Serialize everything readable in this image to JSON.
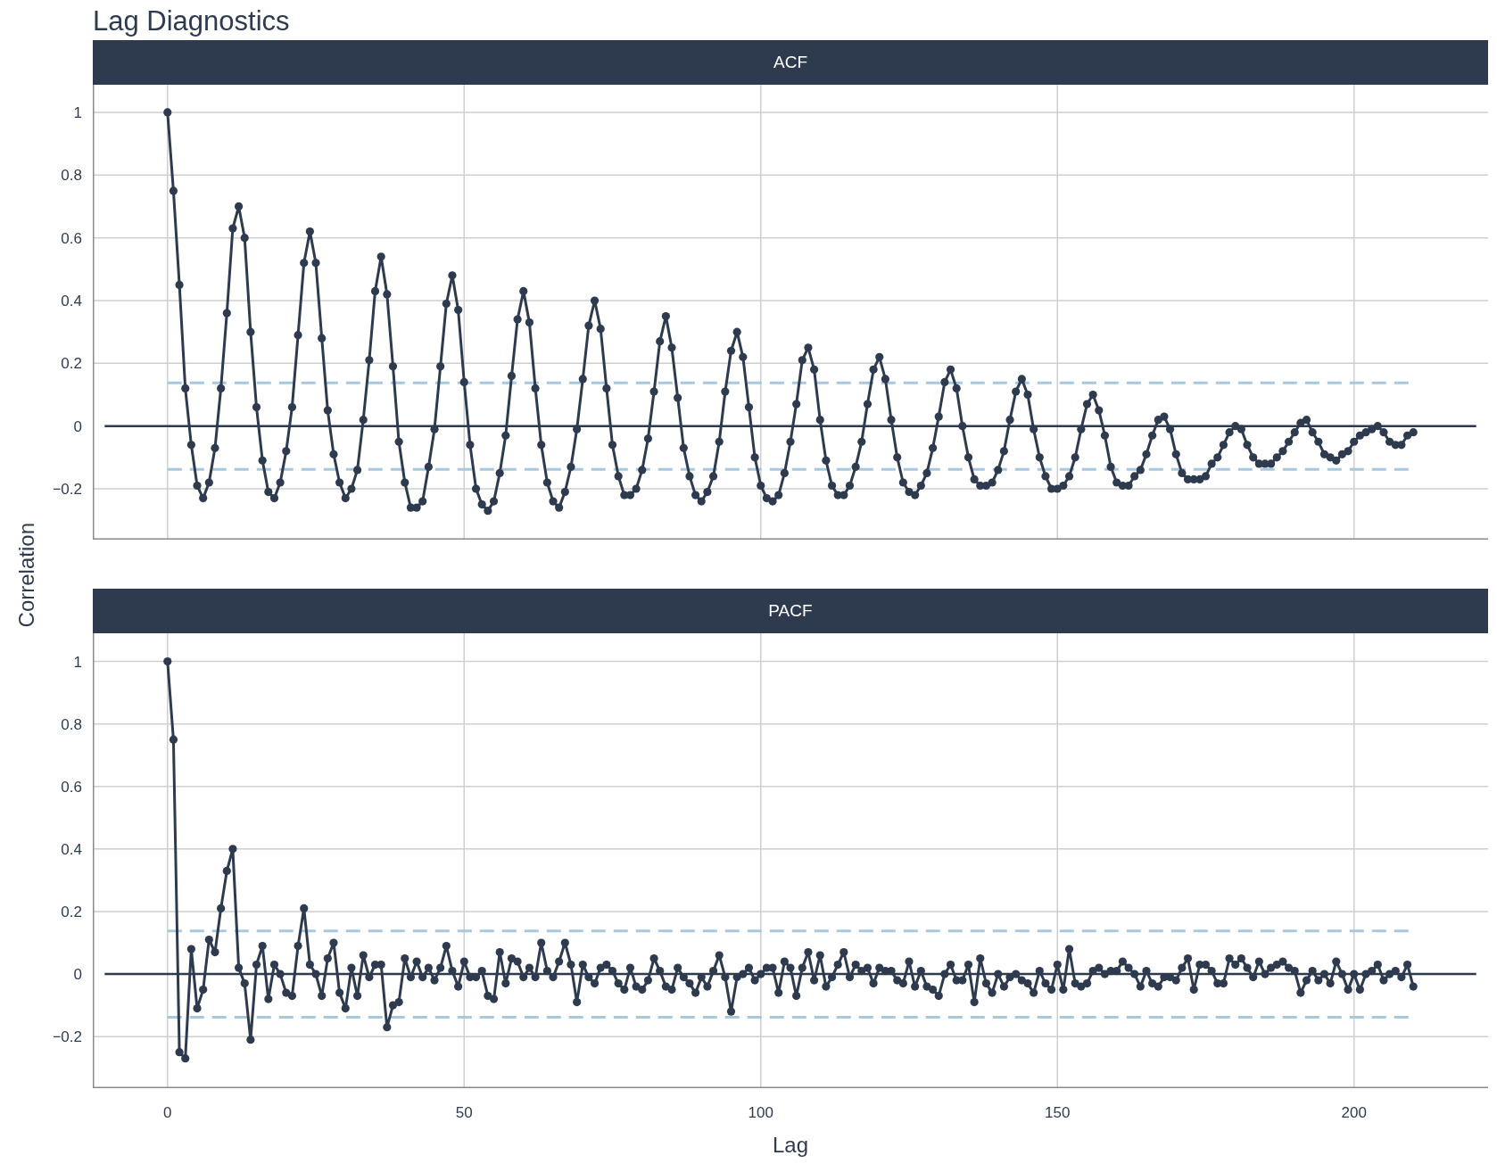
{
  "title": "Lag Diagnostics",
  "ylabel": "Correlation",
  "charts": [
    {
      "chart_data": {
        "type": "line",
        "title": "ACF",
        "x": [
          0,
          1,
          2,
          3,
          4,
          5,
          6,
          7,
          8,
          9,
          10,
          11,
          12,
          13,
          14,
          15,
          16,
          17,
          18,
          19,
          20,
          21,
          22,
          23,
          24,
          25,
          26,
          27,
          28,
          29,
          30,
          31,
          32,
          33,
          34,
          35,
          36,
          37,
          38,
          39,
          40,
          41,
          42,
          43,
          44,
          45,
          46,
          47,
          48,
          49,
          50,
          51,
          52,
          53,
          54,
          55,
          56,
          57,
          58,
          59,
          60,
          61,
          62,
          63,
          64,
          65,
          66,
          67,
          68,
          69,
          70,
          71,
          72,
          73,
          74,
          75,
          76,
          77,
          78,
          79,
          80,
          81,
          82,
          83,
          84,
          85,
          86,
          87,
          88,
          89,
          90,
          91,
          92,
          93,
          94,
          95,
          96,
          97,
          98,
          99,
          100,
          101,
          102,
          103,
          104,
          105,
          106,
          107,
          108,
          109,
          110,
          111,
          112,
          113,
          114,
          115,
          116,
          117,
          118,
          119,
          120,
          121,
          122,
          123,
          124,
          125,
          126,
          127,
          128,
          129,
          130,
          131,
          132,
          133,
          134,
          135,
          136,
          137,
          138,
          139,
          140,
          141,
          142,
          143,
          144,
          145,
          146,
          147,
          148,
          149,
          150,
          151,
          152,
          153,
          154,
          155,
          156,
          157,
          158,
          159,
          160,
          161,
          162,
          163,
          164,
          165,
          166,
          167,
          168,
          169,
          170,
          171,
          172,
          173,
          174,
          175,
          176,
          177,
          178,
          179,
          180,
          181,
          182,
          183,
          184,
          185,
          186,
          187,
          188,
          189,
          190,
          191,
          192,
          193,
          194,
          195,
          196,
          197,
          198,
          199,
          200,
          201,
          202,
          203,
          204,
          205,
          206,
          207,
          208,
          209,
          210
        ],
        "series": [
          {
            "color": "#2e3b4e",
            "marker": "circle",
            "values": [
              1,
              0.75,
              0.45,
              0.12,
              -0.06,
              -0.19,
              -0.23,
              -0.18,
              -0.07,
              0.12,
              0.36,
              0.63,
              0.7,
              0.6,
              0.3,
              0.06,
              -0.11,
              -0.21,
              -0.23,
              -0.18,
              -0.08,
              0.06,
              0.29,
              0.52,
              0.62,
              0.52,
              0.28,
              0.05,
              -0.09,
              -0.18,
              -0.23,
              -0.2,
              -0.14,
              0.02,
              0.21,
              0.43,
              0.54,
              0.42,
              0.19,
              -0.05,
              -0.18,
              -0.26,
              -0.26,
              -0.24,
              -0.13,
              -0.01,
              0.19,
              0.39,
              0.48,
              0.37,
              0.14,
              -0.06,
              -0.2,
              -0.25,
              -0.27,
              -0.24,
              -0.15,
              -0.03,
              0.16,
              0.34,
              0.43,
              0.33,
              0.12,
              -0.06,
              -0.18,
              -0.24,
              -0.26,
              -0.21,
              -0.13,
              -0.01,
              0.15,
              0.32,
              0.4,
              0.31,
              0.12,
              -0.06,
              -0.16,
              -0.22,
              -0.22,
              -0.2,
              -0.14,
              -0.04,
              0.11,
              0.27,
              0.35,
              0.25,
              0.09,
              -0.07,
              -0.16,
              -0.22,
              -0.24,
              -0.21,
              -0.16,
              -0.05,
              0.11,
              0.24,
              0.3,
              0.22,
              0.06,
              -0.1,
              -0.19,
              -0.23,
              -0.24,
              -0.22,
              -0.15,
              -0.05,
              0.07,
              0.21,
              0.25,
              0.18,
              0.02,
              -0.11,
              -0.19,
              -0.22,
              -0.22,
              -0.19,
              -0.13,
              -0.05,
              0.07,
              0.18,
              0.22,
              0.15,
              0.02,
              -0.1,
              -0.18,
              -0.21,
              -0.22,
              -0.19,
              -0.15,
              -0.07,
              0.03,
              0.14,
              0.18,
              0.12,
              0.0,
              -0.1,
              -0.17,
              -0.19,
              -0.19,
              -0.18,
              -0.14,
              -0.08,
              0.02,
              0.11,
              0.15,
              0.1,
              -0.01,
              -0.1,
              -0.16,
              -0.2,
              -0.2,
              -0.19,
              -0.16,
              -0.1,
              -0.01,
              0.07,
              0.1,
              0.05,
              -0.03,
              -0.13,
              -0.18,
              -0.19,
              -0.19,
              -0.16,
              -0.14,
              -0.09,
              -0.03,
              0.02,
              0.03,
              -0.01,
              -0.09,
              -0.15,
              -0.17,
              -0.17,
              -0.17,
              -0.16,
              -0.12,
              -0.1,
              -0.06,
              -0.02,
              0.0,
              -0.01,
              -0.06,
              -0.1,
              -0.12,
              -0.12,
              -0.12,
              -0.1,
              -0.08,
              -0.05,
              -0.02,
              0.01,
              0.02,
              -0.02,
              -0.05,
              -0.09,
              -0.1,
              -0.11,
              -0.09,
              -0.08,
              -0.05,
              -0.03,
              -0.02,
              -0.01,
              0.0,
              -0.02,
              -0.05,
              -0.06,
              -0.06,
              -0.03,
              -0.02
            ]
          }
        ],
        "xlim": [
          -12.6,
          222.6
        ],
        "ylim": [
          -0.362,
          1.088
        ],
        "grid": true,
        "yticks": [
          {
            "value": -0.2,
            "label": "−0.2"
          },
          0,
          0.2,
          0.4,
          0.6,
          0.8,
          1
        ],
        "ref_lines": [
          {
            "axis": "y",
            "value": 0.138
          },
          {
            "axis": "y",
            "value": -0.138
          }
        ]
      }
    },
    {
      "chart_data": {
        "type": "line",
        "title": "PACF",
        "xlabel": "Lag",
        "x": [
          0,
          1,
          2,
          3,
          4,
          5,
          6,
          7,
          8,
          9,
          10,
          11,
          12,
          13,
          14,
          15,
          16,
          17,
          18,
          19,
          20,
          21,
          22,
          23,
          24,
          25,
          26,
          27,
          28,
          29,
          30,
          31,
          32,
          33,
          34,
          35,
          36,
          37,
          38,
          39,
          40,
          41,
          42,
          43,
          44,
          45,
          46,
          47,
          48,
          49,
          50,
          51,
          52,
          53,
          54,
          55,
          56,
          57,
          58,
          59,
          60,
          61,
          62,
          63,
          64,
          65,
          66,
          67,
          68,
          69,
          70,
          71,
          72,
          73,
          74,
          75,
          76,
          77,
          78,
          79,
          80,
          81,
          82,
          83,
          84,
          85,
          86,
          87,
          88,
          89,
          90,
          91,
          92,
          93,
          94,
          95,
          96,
          97,
          98,
          99,
          100,
          101,
          102,
          103,
          104,
          105,
          106,
          107,
          108,
          109,
          110,
          111,
          112,
          113,
          114,
          115,
          116,
          117,
          118,
          119,
          120,
          121,
          122,
          123,
          124,
          125,
          126,
          127,
          128,
          129,
          130,
          131,
          132,
          133,
          134,
          135,
          136,
          137,
          138,
          139,
          140,
          141,
          142,
          143,
          144,
          145,
          146,
          147,
          148,
          149,
          150,
          151,
          152,
          153,
          154,
          155,
          156,
          157,
          158,
          159,
          160,
          161,
          162,
          163,
          164,
          165,
          166,
          167,
          168,
          169,
          170,
          171,
          172,
          173,
          174,
          175,
          176,
          177,
          178,
          179,
          180,
          181,
          182,
          183,
          184,
          185,
          186,
          187,
          188,
          189,
          190,
          191,
          192,
          193,
          194,
          195,
          196,
          197,
          198,
          199,
          200,
          201,
          202,
          203,
          204,
          205,
          206,
          207,
          208,
          209,
          210
        ],
        "series": [
          {
            "color": "#2e3b4e",
            "marker": "circle",
            "values": [
              1,
              0.75,
              -0.25,
              -0.27,
              0.08,
              -0.11,
              -0.05,
              0.11,
              0.07,
              0.21,
              0.33,
              0.4,
              0.02,
              -0.03,
              -0.21,
              0.03,
              0.09,
              -0.08,
              0.03,
              0.0,
              -0.06,
              -0.07,
              0.09,
              0.21,
              0.03,
              0.0,
              -0.07,
              0.05,
              0.1,
              -0.06,
              -0.11,
              0.02,
              -0.07,
              0.06,
              -0.01,
              0.03,
              0.03,
              -0.17,
              -0.1,
              -0.09,
              0.05,
              -0.01,
              0.04,
              -0.01,
              0.02,
              -0.02,
              0.02,
              0.09,
              0.01,
              -0.04,
              0.04,
              -0.01,
              -0.01,
              0.01,
              -0.07,
              -0.08,
              0.07,
              -0.03,
              0.05,
              0.04,
              -0.01,
              0.02,
              -0.01,
              0.1,
              0.01,
              -0.01,
              0.04,
              0.1,
              0.03,
              -0.09,
              0.03,
              -0.01,
              -0.03,
              0.02,
              0.03,
              0.01,
              -0.03,
              -0.05,
              0.02,
              -0.04,
              -0.05,
              -0.02,
              0.05,
              0.01,
              -0.04,
              -0.05,
              0.02,
              -0.01,
              -0.03,
              -0.06,
              -0.01,
              -0.04,
              0.01,
              0.06,
              -0.01,
              -0.12,
              -0.01,
              0.0,
              0.02,
              -0.02,
              0.0,
              0.02,
              0.02,
              -0.06,
              0.04,
              0.02,
              -0.07,
              0.02,
              0.07,
              -0.02,
              0.06,
              -0.04,
              -0.01,
              0.03,
              0.07,
              -0.01,
              0.03,
              0.01,
              0.02,
              -0.03,
              0.02,
              0.01,
              0.01,
              -0.02,
              -0.03,
              0.04,
              -0.04,
              0.01,
              -0.04,
              -0.05,
              -0.07,
              0.0,
              0.03,
              -0.02,
              -0.02,
              0.03,
              -0.09,
              0.05,
              -0.03,
              -0.06,
              0.0,
              -0.04,
              -0.01,
              0.0,
              -0.02,
              -0.03,
              -0.06,
              0.01,
              -0.03,
              -0.05,
              0.03,
              -0.05,
              0.08,
              -0.03,
              -0.04,
              -0.03,
              0.01,
              0.02,
              0.0,
              0.01,
              0.01,
              0.04,
              0.02,
              0.0,
              -0.04,
              0.01,
              -0.03,
              -0.04,
              -0.01,
              -0.01,
              -0.02,
              0.02,
              0.05,
              -0.05,
              0.03,
              0.03,
              0.01,
              -0.03,
              -0.03,
              0.05,
              0.03,
              0.05,
              0.02,
              -0.01,
              0.04,
              0.0,
              0.02,
              0.03,
              0.04,
              0.02,
              0.01,
              -0.06,
              -0.02,
              0.01,
              -0.02,
              0.0,
              -0.03,
              0.04,
              0.0,
              -0.05,
              0.0,
              -0.05,
              0.0,
              0.01,
              0.03,
              -0.02,
              0.0,
              0.01,
              -0.01,
              0.03,
              -0.04
            ]
          }
        ],
        "xlim": [
          -12.6,
          222.6
        ],
        "ylim": [
          -0.365,
          1.09
        ],
        "grid": true,
        "xticks": [
          0,
          50,
          100,
          150,
          200
        ],
        "yticks": [
          {
            "value": -0.2,
            "label": "−0.2"
          },
          0,
          0.2,
          0.4,
          0.6,
          0.8,
          1
        ],
        "ref_lines": [
          {
            "axis": "y",
            "value": 0.138
          },
          {
            "axis": "y",
            "value": -0.138
          }
        ]
      }
    }
  ]
}
